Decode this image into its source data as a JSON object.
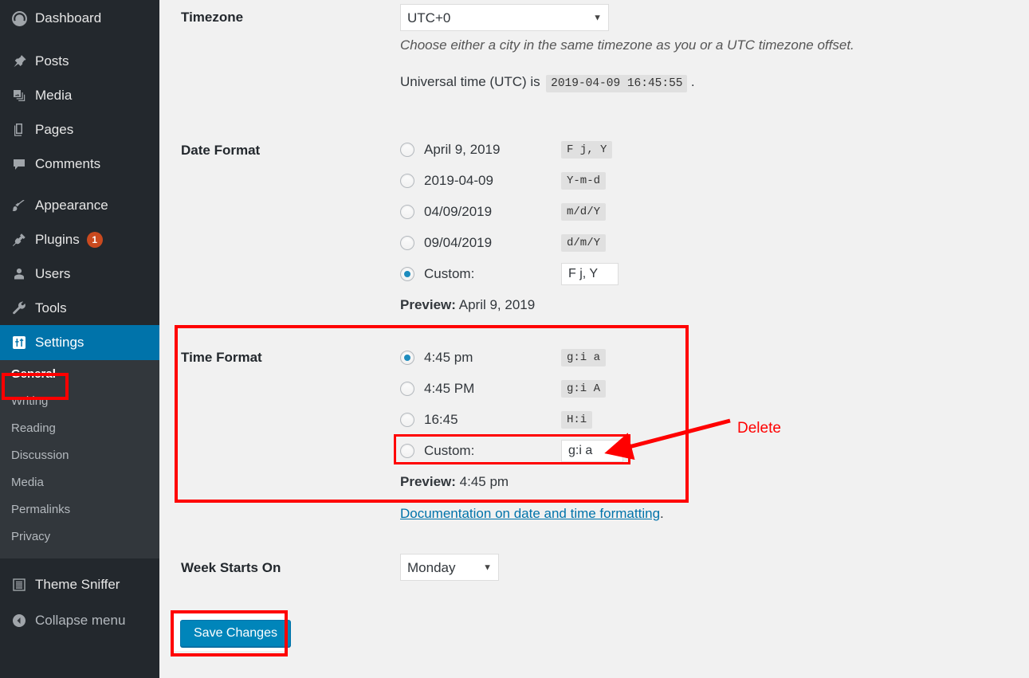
{
  "sidebar": {
    "items": [
      {
        "label": "Dashboard",
        "icon": "dashboard-icon",
        "badge": null
      },
      {
        "label": "Posts",
        "icon": "pin-icon",
        "badge": null
      },
      {
        "label": "Media",
        "icon": "media-icon",
        "badge": null
      },
      {
        "label": "Pages",
        "icon": "pages-icon",
        "badge": null
      },
      {
        "label": "Comments",
        "icon": "comment-icon",
        "badge": null
      },
      {
        "label": "Appearance",
        "icon": "brush-icon",
        "badge": null
      },
      {
        "label": "Plugins",
        "icon": "plug-icon",
        "badge": "1"
      },
      {
        "label": "Users",
        "icon": "user-icon",
        "badge": null
      },
      {
        "label": "Tools",
        "icon": "wrench-icon",
        "badge": null
      },
      {
        "label": "Settings",
        "icon": "settings-icon",
        "badge": null
      }
    ],
    "submenu": [
      {
        "label": "General",
        "current": true
      },
      {
        "label": "Writing",
        "current": false
      },
      {
        "label": "Reading",
        "current": false
      },
      {
        "label": "Discussion",
        "current": false
      },
      {
        "label": "Media",
        "current": false
      },
      {
        "label": "Permalinks",
        "current": false
      },
      {
        "label": "Privacy",
        "current": false
      }
    ],
    "theme_sniffer": {
      "label": "Theme Sniffer",
      "icon": "list-icon"
    },
    "collapse": {
      "label": "Collapse menu",
      "icon": "collapse-arrow-icon"
    },
    "colors": {
      "bg": "#23282d",
      "submenu_bg": "#32373c",
      "active": "#0073aa",
      "badge": "#ca4a1f"
    }
  },
  "timezone": {
    "label": "Timezone",
    "value": "UTC+0",
    "options": [
      "UTC+0"
    ],
    "description": "Choose either a city in the same timezone as you or a UTC timezone offset.",
    "universal_time_prefix": "Universal time (UTC) is",
    "universal_time_value": "2019-04-09 16:45:55",
    "universal_time_suffix": "."
  },
  "date_format": {
    "label": "Date Format",
    "options": [
      {
        "display": "April 9, 2019",
        "code": "F j, Y",
        "selected": false
      },
      {
        "display": "2019-04-09",
        "code": "Y-m-d",
        "selected": false
      },
      {
        "display": "04/09/2019",
        "code": "m/d/Y",
        "selected": false
      },
      {
        "display": "09/04/2019",
        "code": "d/m/Y",
        "selected": false
      }
    ],
    "custom_label": "Custom:",
    "custom_selected": true,
    "custom_value": "F j, Y",
    "preview_label": "Preview:",
    "preview_value": "April 9, 2019"
  },
  "time_format": {
    "label": "Time Format",
    "options": [
      {
        "display": "4:45 pm",
        "code": "g:i a",
        "selected": true
      },
      {
        "display": "4:45 PM",
        "code": "g:i A",
        "selected": false
      },
      {
        "display": "16:45",
        "code": "H:i",
        "selected": false
      }
    ],
    "custom_label": "Custom:",
    "custom_selected": false,
    "custom_value": "g:i a",
    "preview_label": "Preview:",
    "preview_value": "4:45 pm"
  },
  "documentation_link": {
    "text": "Documentation on date and time formatting",
    "suffix": "."
  },
  "week_starts_on": {
    "label": "Week Starts On",
    "value": "Monday",
    "options": [
      "Monday"
    ]
  },
  "save": {
    "label": "Save Changes"
  },
  "annotations": {
    "color": "#ff0000",
    "delete_label": "Delete"
  }
}
